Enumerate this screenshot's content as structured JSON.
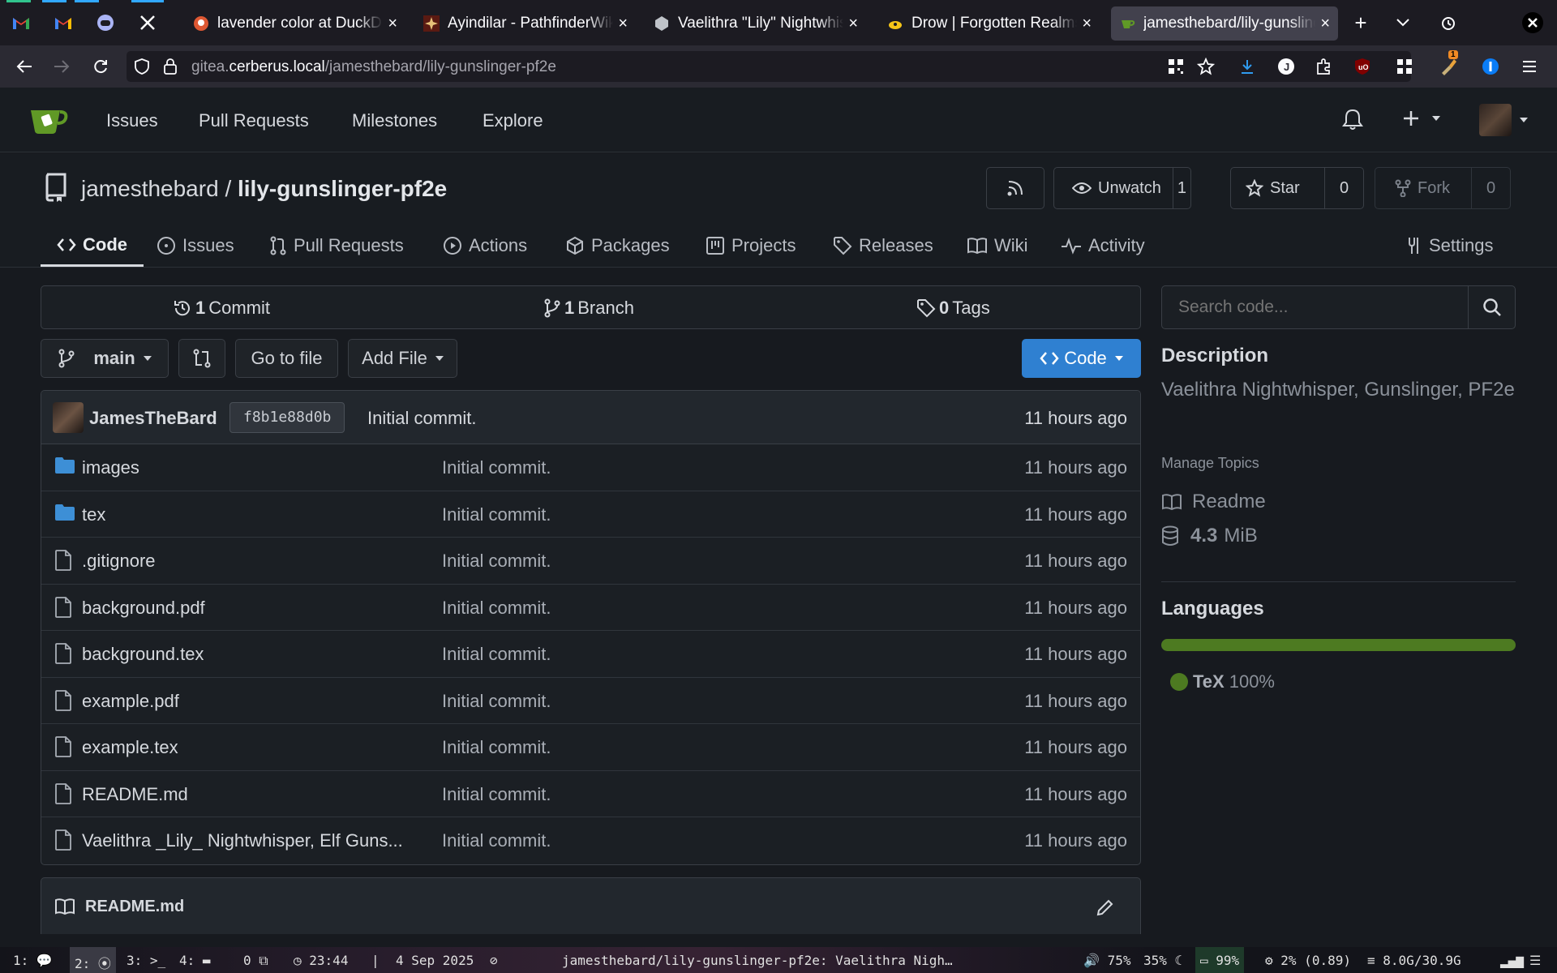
{
  "browser": {
    "tabs": [
      {
        "title": "lavender color at DuckDuckGo",
        "favicon": "duckduckgo-icon"
      },
      {
        "title": "Ayindilar - PathfinderWiki",
        "favicon": "pathfinder-wiki-icon"
      },
      {
        "title": "Vaelithra \"Lily\" Nightwhisper",
        "favicon": "d20-icon"
      },
      {
        "title": "Drow | Forgotten Realms Wiki",
        "favicon": "fandom-icon"
      },
      {
        "title": "jamesthebard/lily-gunslinger",
        "favicon": "gitea-icon",
        "active": true
      }
    ],
    "pinned": [
      "gmail-icon",
      "gmail-icon",
      "discord-icon",
      "x-icon"
    ],
    "close_x": "×",
    "url_prefix": "gitea.",
    "url_host": "cerberus.local",
    "url_path": "/jamesthebard/lily-gunslinger-pf2e",
    "downloads_badge": "1"
  },
  "gitea": {
    "nav": [
      "Issues",
      "Pull Requests",
      "Milestones",
      "Explore"
    ],
    "accent": "#609926"
  },
  "repo": {
    "owner": "jamesthebard",
    "separator": "/",
    "name": "lily-gunslinger-pf2e",
    "unwatch_label": "Unwatch",
    "watch_count": "1",
    "star_label": "Star",
    "star_count": "0",
    "fork_label": "Fork",
    "fork_count": "0",
    "tabs": [
      "Code",
      "Issues",
      "Pull Requests",
      "Actions",
      "Packages",
      "Projects",
      "Releases",
      "Wiki",
      "Activity"
    ],
    "settings_label": "Settings"
  },
  "stats": {
    "commits_num": "1",
    "commits_label": "Commit",
    "branches_num": "1",
    "branches_label": "Branch",
    "tags_num": "0",
    "tags_label": "Tags"
  },
  "toolbar": {
    "branch": "main",
    "go_to_file": "Go to file",
    "add_file": "Add File",
    "code": "Code"
  },
  "latest_commit": {
    "author": "JamesTheBard",
    "sha": "f8b1e88d0b",
    "message": "Initial commit.",
    "time": "11 hours ago"
  },
  "files": [
    {
      "name": "images",
      "type": "folder",
      "message": "Initial commit.",
      "time": "11 hours ago"
    },
    {
      "name": "tex",
      "type": "folder",
      "message": "Initial commit.",
      "time": "11 hours ago"
    },
    {
      "name": ".gitignore",
      "type": "file",
      "message": "Initial commit.",
      "time": "11 hours ago"
    },
    {
      "name": "background.pdf",
      "type": "file",
      "message": "Initial commit.",
      "time": "11 hours ago"
    },
    {
      "name": "background.tex",
      "type": "file",
      "message": "Initial commit.",
      "time": "11 hours ago"
    },
    {
      "name": "example.pdf",
      "type": "file",
      "message": "Initial commit.",
      "time": "11 hours ago"
    },
    {
      "name": "example.tex",
      "type": "file",
      "message": "Initial commit.",
      "time": "11 hours ago"
    },
    {
      "name": "README.md",
      "type": "file",
      "message": "Initial commit.",
      "time": "11 hours ago"
    },
    {
      "name": "Vaelithra _Lily_ Nightwhisper, Elf Guns...",
      "type": "file",
      "message": "Initial commit.",
      "time": "11 hours ago"
    }
  ],
  "readme": {
    "title": "README.md"
  },
  "sidebar": {
    "search_placeholder": "Search code...",
    "description_heading": "Description",
    "description": "Vaelithra Nightwhisper, Gunslinger, PF2e",
    "manage_topics": "Manage Topics",
    "readme_label": "Readme",
    "size_value": "4.3",
    "size_unit": "MiB",
    "languages_heading": "Languages",
    "languages": [
      {
        "name": "TeX",
        "percent": "100%",
        "fraction": 1.0,
        "color": "#4d7a21"
      }
    ]
  },
  "taskbar": {
    "workspaces": [
      "1:",
      "2:",
      "3:",
      "4:"
    ],
    "counter": "0",
    "time": "23:44",
    "divider": "|",
    "date": "4 Sep 2025",
    "window_title": "jamesthebard/lily-gunslinger-pf2e: Vaelithra Nigh…",
    "volume": "75%",
    "brightness": "35%",
    "battery": "99%",
    "cpu": "2% (0.89)",
    "memory": "8.0G/30.9G"
  }
}
